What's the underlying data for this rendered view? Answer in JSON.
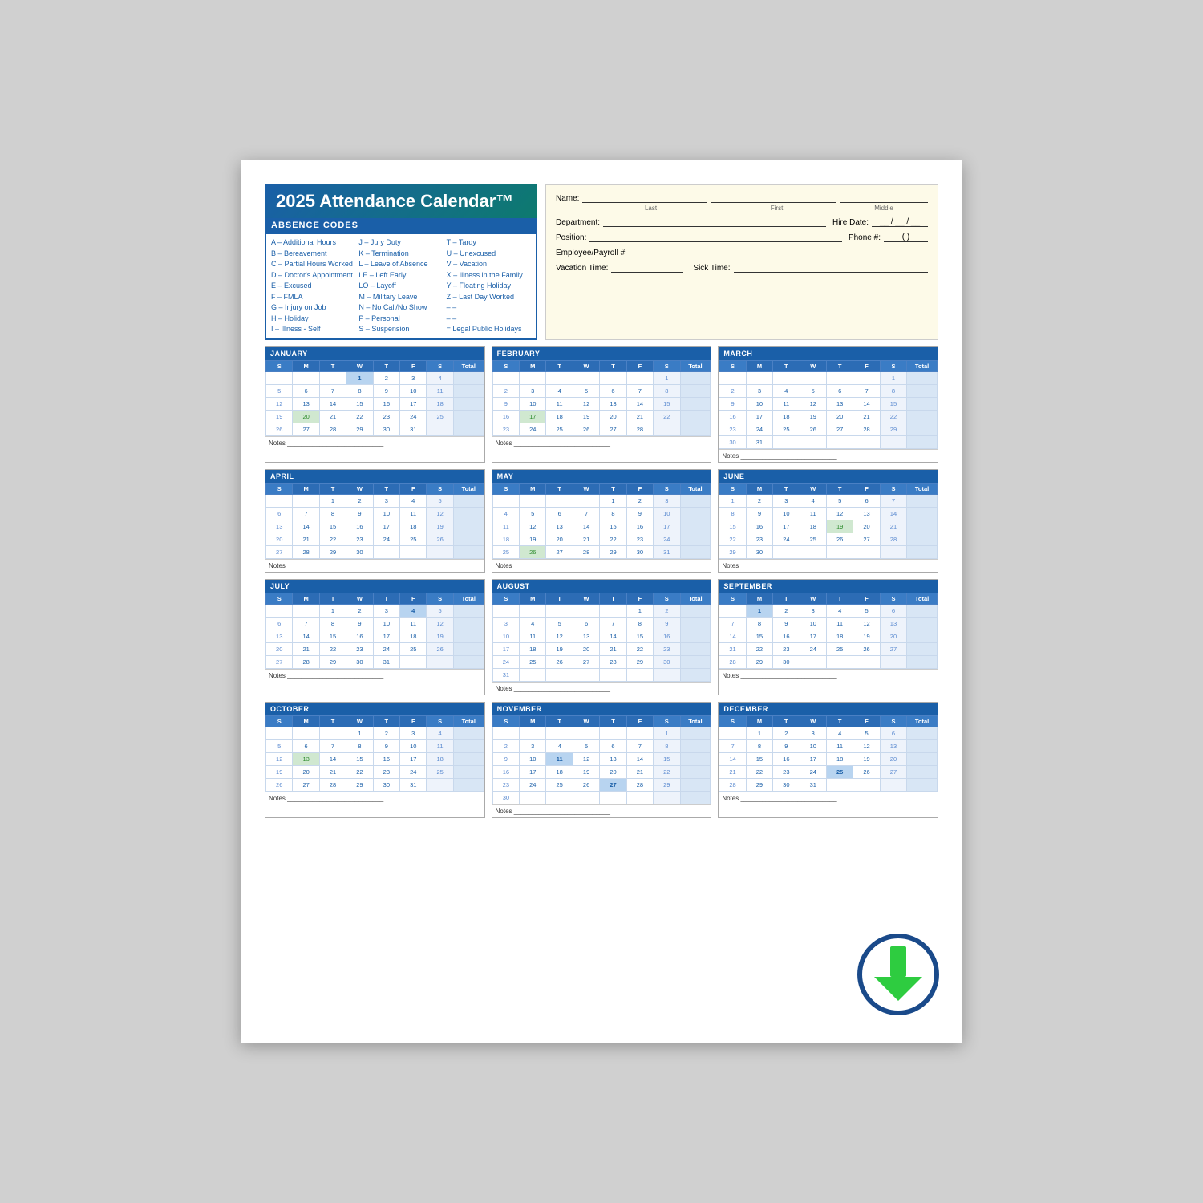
{
  "title": "2025 Attendance Calendar™",
  "absence_codes": {
    "header": "ABSENCE CODES",
    "col1": [
      "A – Additional Hours",
      "B – Bereavement",
      "C – Partial Hours Worked",
      "D – Doctor's Appointment",
      "E – Excused",
      "F – FMLA",
      "G – Injury on Job",
      "H – Holiday",
      "I  – Illness - Self"
    ],
    "col2": [
      "J  – Jury Duty",
      "K – Termination",
      "L  – Leave of Absence",
      "LE – Left Early",
      "LO – Layoff",
      "M – Military Leave",
      "N – No Call/No Show",
      "P  – Personal",
      "S  – Suspension"
    ],
    "col3": [
      "T  – Tardy",
      "U – Unexcused",
      "V – Vacation",
      "X – Illness in the Family",
      "Y – Floating Holiday",
      "Z – Last Day Worked",
      "– –",
      "– –",
      "= Legal Public Holidays"
    ]
  },
  "form": {
    "name_label": "Name:",
    "last_label": "Last",
    "first_label": "First",
    "middle_label": "Middle",
    "department_label": "Department:",
    "hire_date_label": "Hire Date:",
    "hire_date_format": "__ / __ / __",
    "position_label": "Position:",
    "phone_label": "Phone #:",
    "phone_format": "(    )",
    "employee_label": "Employee/Payroll #:",
    "vacation_label": "Vacation Time:",
    "sick_label": "Sick Time:"
  },
  "months": [
    {
      "name": "JANUARY",
      "days": [
        [
          "",
          "",
          "",
          "1",
          "2",
          "3",
          "4",
          ""
        ],
        [
          "5",
          "6",
          "7",
          "8",
          "9",
          "10",
          "11",
          ""
        ],
        [
          "12",
          "13",
          "14",
          "15",
          "16",
          "17",
          "18",
          ""
        ],
        [
          "19",
          "20",
          "21",
          "22",
          "23",
          "24",
          "25",
          ""
        ],
        [
          "26",
          "27",
          "28",
          "29",
          "30",
          "31",
          "",
          ""
        ]
      ],
      "holidays": [
        "1"
      ],
      "alt_holidays": [
        "20"
      ]
    },
    {
      "name": "FEBRUARY",
      "days": [
        [
          "",
          "",
          "",
          "",
          "",
          "",
          "1",
          ""
        ],
        [
          "2",
          "3",
          "4",
          "5",
          "6",
          "7",
          "8",
          ""
        ],
        [
          "9",
          "10",
          "11",
          "12",
          "13",
          "14",
          "15",
          ""
        ],
        [
          "16",
          "17",
          "18",
          "19",
          "20",
          "21",
          "22",
          ""
        ],
        [
          "23",
          "24",
          "25",
          "26",
          "27",
          "28",
          "",
          ""
        ]
      ],
      "holidays": [],
      "alt_holidays": [
        "17"
      ]
    },
    {
      "name": "MARCH",
      "days": [
        [
          "",
          "",
          "",
          "",
          "",
          "",
          "1",
          ""
        ],
        [
          "2",
          "3",
          "4",
          "5",
          "6",
          "7",
          "8",
          ""
        ],
        [
          "9",
          "10",
          "11",
          "12",
          "13",
          "14",
          "15",
          ""
        ],
        [
          "16",
          "17",
          "18",
          "19",
          "20",
          "21",
          "22",
          ""
        ],
        [
          "23",
          "24",
          "25",
          "26",
          "27",
          "28",
          "29",
          ""
        ],
        [
          "30",
          "31",
          "",
          "",
          "",
          "",
          "",
          ""
        ]
      ],
      "holidays": [],
      "alt_holidays": []
    },
    {
      "name": "APRIL",
      "days": [
        [
          "",
          "",
          "1",
          "2",
          "3",
          "4",
          "5",
          ""
        ],
        [
          "6",
          "7",
          "8",
          "9",
          "10",
          "11",
          "12",
          ""
        ],
        [
          "13",
          "14",
          "15",
          "16",
          "17",
          "18",
          "19",
          ""
        ],
        [
          "20",
          "21",
          "22",
          "23",
          "24",
          "25",
          "26",
          ""
        ],
        [
          "27",
          "28",
          "29",
          "30",
          "",
          "",
          "",
          ""
        ]
      ],
      "holidays": [],
      "alt_holidays": []
    },
    {
      "name": "MAY",
      "days": [
        [
          "",
          "",
          "",
          "",
          "1",
          "2",
          "3",
          ""
        ],
        [
          "4",
          "5",
          "6",
          "7",
          "8",
          "9",
          "10",
          ""
        ],
        [
          "11",
          "12",
          "13",
          "14",
          "15",
          "16",
          "17",
          ""
        ],
        [
          "18",
          "19",
          "20",
          "21",
          "22",
          "23",
          "24",
          ""
        ],
        [
          "25",
          "26",
          "27",
          "28",
          "29",
          "30",
          "31",
          ""
        ]
      ],
      "holidays": [],
      "alt_holidays": [
        "26"
      ]
    },
    {
      "name": "JUNE",
      "days": [
        [
          "1",
          "2",
          "3",
          "4",
          "5",
          "6",
          "7",
          ""
        ],
        [
          "8",
          "9",
          "10",
          "11",
          "12",
          "13",
          "14",
          ""
        ],
        [
          "15",
          "16",
          "17",
          "18",
          "19",
          "20",
          "21",
          ""
        ],
        [
          "22",
          "23",
          "24",
          "25",
          "26",
          "27",
          "28",
          ""
        ],
        [
          "29",
          "30",
          "",
          "",
          "",
          "",
          "",
          ""
        ]
      ],
      "holidays": [],
      "alt_holidays": [
        "19"
      ]
    },
    {
      "name": "JULY",
      "days": [
        [
          "",
          "",
          "1",
          "2",
          "3",
          "4",
          "5",
          ""
        ],
        [
          "6",
          "7",
          "8",
          "9",
          "10",
          "11",
          "12",
          ""
        ],
        [
          "13",
          "14",
          "15",
          "16",
          "17",
          "18",
          "19",
          ""
        ],
        [
          "20",
          "21",
          "22",
          "23",
          "24",
          "25",
          "26",
          ""
        ],
        [
          "27",
          "28",
          "29",
          "30",
          "31",
          "",
          "",
          ""
        ]
      ],
      "holidays": [
        "4"
      ],
      "alt_holidays": []
    },
    {
      "name": "AUGUST",
      "days": [
        [
          "",
          "",
          "",
          "",
          "",
          "1",
          "2",
          ""
        ],
        [
          "3",
          "4",
          "5",
          "6",
          "7",
          "8",
          "9",
          ""
        ],
        [
          "10",
          "11",
          "12",
          "13",
          "14",
          "15",
          "16",
          ""
        ],
        [
          "17",
          "18",
          "19",
          "20",
          "21",
          "22",
          "23",
          ""
        ],
        [
          "24",
          "25",
          "26",
          "27",
          "28",
          "29",
          "30",
          ""
        ],
        [
          "31",
          "",
          "",
          "",
          "",
          "",
          "",
          ""
        ]
      ],
      "holidays": [],
      "alt_holidays": []
    },
    {
      "name": "SEPTEMBER",
      "days": [
        [
          "",
          "1",
          "2",
          "3",
          "4",
          "5",
          "6",
          ""
        ],
        [
          "7",
          "8",
          "9",
          "10",
          "11",
          "12",
          "13",
          ""
        ],
        [
          "14",
          "15",
          "16",
          "17",
          "18",
          "19",
          "20",
          ""
        ],
        [
          "21",
          "22",
          "23",
          "24",
          "25",
          "26",
          "27",
          ""
        ],
        [
          "28",
          "29",
          "30",
          "",
          "",
          "",
          "",
          ""
        ]
      ],
      "holidays": [
        "1"
      ],
      "alt_holidays": []
    },
    {
      "name": "OCTOBER",
      "days": [
        [
          "",
          "",
          "",
          "1",
          "2",
          "3",
          "4",
          ""
        ],
        [
          "5",
          "6",
          "7",
          "8",
          "9",
          "10",
          "11",
          ""
        ],
        [
          "12",
          "13",
          "14",
          "15",
          "16",
          "17",
          "18",
          ""
        ],
        [
          "19",
          "20",
          "21",
          "22",
          "23",
          "24",
          "25",
          ""
        ],
        [
          "26",
          "27",
          "28",
          "29",
          "30",
          "31",
          "",
          ""
        ]
      ],
      "holidays": [],
      "alt_holidays": [
        "13"
      ]
    },
    {
      "name": "NOVEMBER",
      "days": [
        [
          "",
          "",
          "",
          "",
          "",
          "",
          "1",
          ""
        ],
        [
          "2",
          "3",
          "4",
          "5",
          "6",
          "7",
          "8",
          ""
        ],
        [
          "9",
          "10",
          "11",
          "12",
          "13",
          "14",
          "15",
          ""
        ],
        [
          "16",
          "17",
          "18",
          "19",
          "20",
          "21",
          "22",
          ""
        ],
        [
          "23",
          "24",
          "25",
          "26",
          "27",
          "28",
          "29",
          ""
        ],
        [
          "30",
          "",
          "",
          "",
          "",
          "",
          "",
          ""
        ]
      ],
      "holidays": [
        "11",
        "27"
      ],
      "alt_holidays": []
    },
    {
      "name": "DECEMBER",
      "days": [
        [
          "",
          "1",
          "2",
          "3",
          "4",
          "5",
          "6",
          ""
        ],
        [
          "7",
          "8",
          "9",
          "10",
          "11",
          "12",
          "13",
          ""
        ],
        [
          "14",
          "15",
          "16",
          "17",
          "18",
          "19",
          "20",
          ""
        ],
        [
          "21",
          "22",
          "23",
          "24",
          "25",
          "26",
          "27",
          ""
        ],
        [
          "28",
          "29",
          "30",
          "31",
          "",
          "",
          "",
          ""
        ]
      ],
      "holidays": [
        "25"
      ],
      "alt_holidays": []
    }
  ],
  "col_headers": [
    "S",
    "M",
    "T",
    "W",
    "T",
    "F",
    "S",
    "Total"
  ],
  "notes_label": "Notes",
  "download_icon": "⬇"
}
